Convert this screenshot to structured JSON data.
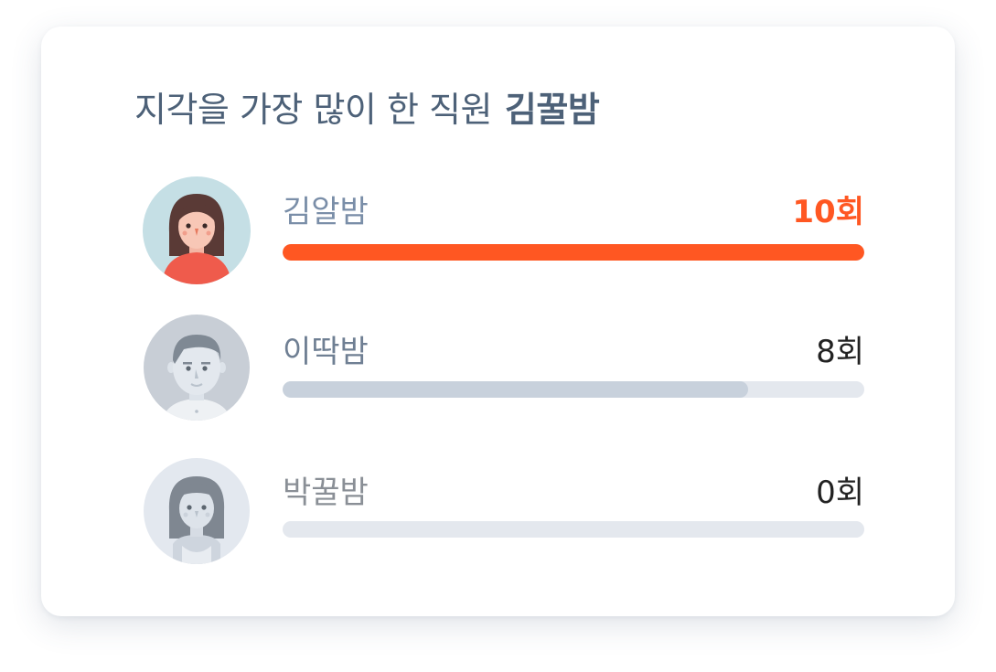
{
  "card": {
    "title": "지각을 가장 많이 한 직원",
    "top_employee": "김꿀밤"
  },
  "employees": [
    {
      "name": "김알밤",
      "count_label": "10회",
      "count": 10,
      "bar_fraction": 1.0,
      "avatar_icon": "woman-avatar-icon",
      "bar_color": "#ff5722"
    },
    {
      "name": "이딱밤",
      "count_label": "8회",
      "count": 8,
      "bar_fraction": 0.8,
      "avatar_icon": "man-avatar-icon",
      "bar_color": "#c8d1dc"
    },
    {
      "name": "박꿀밤",
      "count_label": "0회",
      "count": 0,
      "bar_fraction": 0,
      "avatar_icon": "woman-bangs-avatar-icon",
      "bar_color": "#c8d1dc"
    }
  ],
  "colors": {
    "accent": "#ff5722",
    "title_text": "#4d6178",
    "track": "#e4e8ee"
  }
}
